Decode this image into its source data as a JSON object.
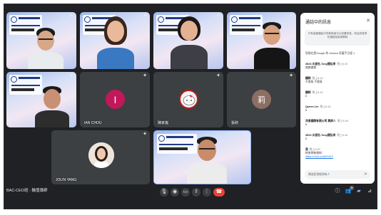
{
  "meeting": {
    "title": "BAC-CEO班 - 輪值導師"
  },
  "tiles": [
    {
      "id": "t1",
      "name": "",
      "kind": "video"
    },
    {
      "id": "t2",
      "name": "",
      "kind": "video"
    },
    {
      "id": "t3",
      "name": "",
      "kind": "video"
    },
    {
      "id": "t4",
      "name": "",
      "kind": "video"
    },
    {
      "id": "t5",
      "name": "",
      "kind": "video"
    },
    {
      "id": "t6",
      "name": "IAN CHOU",
      "kind": "avatar",
      "initial": "I",
      "color": "#c2185b"
    },
    {
      "id": "t7",
      "name": "陳家嵐",
      "kind": "avatar-image"
    },
    {
      "id": "t8",
      "name": "張莉",
      "kind": "avatar",
      "initial": "莉",
      "color": "#8d6e63"
    },
    {
      "id": "t9",
      "name": "JOLIN YANG",
      "kind": "video"
    },
    {
      "id": "t10",
      "name": "",
      "kind": "video"
    }
  ],
  "chat": {
    "title": "通話中的訊息",
    "notice": "只有這個通話中的參與者可以查看訊息，而且訊息會在通話結束後刪除",
    "messages": [
      {
        "who": "",
        "time": "",
        "text": "您現在是Google 的 Jessica 而著手日程 1"
      },
      {
        "who": "3523 水道社-Tony顏弘來",
        "time": "晚上8:45",
        "text": "謝謝謝謝"
      },
      {
        "who": "鐵師",
        "time": "晚上8:45",
        "text": "不客氣 不客氣"
      },
      {
        "who": "鐵師",
        "time": "晚上8:45",
        "text": "8"
      },
      {
        "who": "Queen Lin",
        "time": "晚上8:46",
        "text": "8"
      },
      {
        "who": "洋食國際有限公司 黃詩人",
        "time": "晚上8:46",
        "text": "8"
      },
      {
        "who": "3523 水道社-Tony顏弘來",
        "time": "晚上8:46",
        "text": "8"
      },
      {
        "who": "我",
        "time": "晚上8:49",
        "text": "結束問卷連結：",
        "link": "https://reurl.cc/d0XVK2"
      }
    ],
    "input_placeholder": "傳送訊息給所有人"
  },
  "controls": {
    "mic": "mic-icon",
    "camera": "camera-icon",
    "present": "present-icon",
    "raise_hand": "raise-hand-icon",
    "captions": "captions-icon",
    "more": "more-icon",
    "end": "end-call-icon",
    "people_count": "9"
  },
  "colors": {
    "background": "#202124",
    "end_call": "#ea4335",
    "link": "#1a73e8"
  }
}
